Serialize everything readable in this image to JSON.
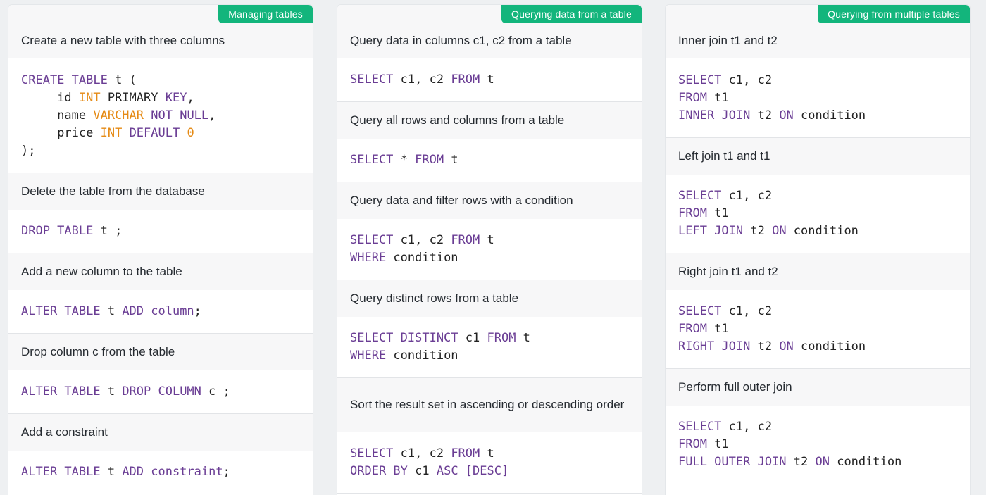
{
  "columns": [
    {
      "badge": "Managing tables",
      "sections": [
        {
          "title": "Create a new table with three columns",
          "title_h": 76,
          "code_h": 163,
          "lines": [
            [
              {
                "t": "CREATE TABLE",
                "c": "k"
              },
              {
                "t": " t (",
                "c": "p"
              }
            ],
            [
              {
                "t": "     id ",
                "c": "p"
              },
              {
                "t": "INT",
                "c": "t"
              },
              {
                "t": " PRIMARY ",
                "c": "p"
              },
              {
                "t": "KEY",
                "c": "k"
              },
              {
                "t": ",",
                "c": "p"
              }
            ],
            [
              {
                "t": "     name ",
                "c": "p"
              },
              {
                "t": "VARCHAR",
                "c": "t"
              },
              {
                "t": " ",
                "c": "p"
              },
              {
                "t": "NOT NULL",
                "c": "k"
              },
              {
                "t": ",",
                "c": "p"
              }
            ],
            [
              {
                "t": "     price ",
                "c": "p"
              },
              {
                "t": "INT",
                "c": "t"
              },
              {
                "t": " ",
                "c": "p"
              },
              {
                "t": "DEFAULT",
                "c": "k"
              },
              {
                "t": " ",
                "c": "p"
              },
              {
                "t": "0",
                "c": "t"
              }
            ],
            [
              {
                "t": ");",
                "c": "p"
              }
            ]
          ]
        },
        {
          "title": "Delete the table from the database",
          "title_h": 52,
          "code_h": 62,
          "lines": [
            [
              {
                "t": "DROP TABLE",
                "c": "k"
              },
              {
                "t": " t ;",
                "c": "p"
              }
            ]
          ]
        },
        {
          "title": "Add a new column to the table",
          "title_h": 52,
          "code_h": 62,
          "lines": [
            [
              {
                "t": "ALTER TABLE",
                "c": "k"
              },
              {
                "t": " t ",
                "c": "p"
              },
              {
                "t": "ADD column",
                "c": "k"
              },
              {
                "t": ";",
                "c": "p"
              }
            ]
          ]
        },
        {
          "title": "Drop column c from the table",
          "title_h": 52,
          "code_h": 62,
          "lines": [
            [
              {
                "t": "ALTER TABLE",
                "c": "k"
              },
              {
                "t": " t ",
                "c": "p"
              },
              {
                "t": "DROP COLUMN",
                "c": "k"
              },
              {
                "t": " c ;",
                "c": "p"
              }
            ]
          ]
        },
        {
          "title": "Add a constraint",
          "title_h": 52,
          "code_h": 62,
          "lines": [
            [
              {
                "t": "ALTER TABLE",
                "c": "k"
              },
              {
                "t": " t ",
                "c": "p"
              },
              {
                "t": "ADD constraint",
                "c": "k"
              },
              {
                "t": ";",
                "c": "p"
              }
            ]
          ]
        }
      ]
    },
    {
      "badge": "Querying data from a table",
      "sections": [
        {
          "title": "Query data in columns c1, c2 from a table",
          "title_h": 76,
          "code_h": 62,
          "lines": [
            [
              {
                "t": "SELECT",
                "c": "k"
              },
              {
                "t": " c1, c2 ",
                "c": "p"
              },
              {
                "t": "FROM",
                "c": "k"
              },
              {
                "t": " t",
                "c": "p"
              }
            ]
          ]
        },
        {
          "title": "Query all rows and columns from a table",
          "title_h": 52,
          "code_h": 62,
          "lines": [
            [
              {
                "t": "SELECT",
                "c": "k"
              },
              {
                "t": " * ",
                "c": "p"
              },
              {
                "t": "FROM",
                "c": "k"
              },
              {
                "t": " t",
                "c": "p"
              }
            ]
          ]
        },
        {
          "title": "Query data and filter rows with a condition",
          "title_h": 52,
          "code_h": 87,
          "lines": [
            [
              {
                "t": "SELECT",
                "c": "k"
              },
              {
                "t": " c1, c2 ",
                "c": "p"
              },
              {
                "t": "FROM",
                "c": "k"
              },
              {
                "t": " t",
                "c": "p"
              }
            ],
            [
              {
                "t": "WHERE",
                "c": "k"
              },
              {
                "t": " condition",
                "c": "p"
              }
            ]
          ]
        },
        {
          "title": "Query distinct rows from a table",
          "title_h": 52,
          "code_h": 87,
          "lines": [
            [
              {
                "t": "SELECT DISTINCT",
                "c": "k"
              },
              {
                "t": " c1 ",
                "c": "p"
              },
              {
                "t": "FROM",
                "c": "k"
              },
              {
                "t": " t",
                "c": "p"
              }
            ],
            [
              {
                "t": "WHERE",
                "c": "k"
              },
              {
                "t": " condition",
                "c": "p"
              }
            ]
          ]
        },
        {
          "title": "Sort the result set in ascending or descending order",
          "title_h": 76,
          "code_h": 88,
          "lines": [
            [
              {
                "t": "SELECT",
                "c": "k"
              },
              {
                "t": " c1, c2 ",
                "c": "p"
              },
              {
                "t": "FROM",
                "c": "k"
              },
              {
                "t": " t",
                "c": "p"
              }
            ],
            [
              {
                "t": "ORDER BY",
                "c": "k"
              },
              {
                "t": " c1 ",
                "c": "p"
              },
              {
                "t": "ASC",
                "c": "k"
              },
              {
                "t": " [DESC]",
                "c": "k"
              }
            ]
          ]
        }
      ]
    },
    {
      "badge": "Querying from multiple tables",
      "sections": [
        {
          "title": "Inner join t1 and t2",
          "title_h": 76,
          "code_h": 113,
          "lines": [
            [
              {
                "t": "SELECT",
                "c": "k"
              },
              {
                "t": " c1, c2",
                "c": "p"
              }
            ],
            [
              {
                "t": "FROM",
                "c": "k"
              },
              {
                "t": " t1",
                "c": "p"
              }
            ],
            [
              {
                "t": "INNER JOIN",
                "c": "k"
              },
              {
                "t": " t2 ",
                "c": "p"
              },
              {
                "t": "ON",
                "c": "k"
              },
              {
                "t": " condition",
                "c": "p"
              }
            ]
          ]
        },
        {
          "title": "Left join t1 and t1",
          "title_h": 52,
          "code_h": 112,
          "lines": [
            [
              {
                "t": "SELECT",
                "c": "k"
              },
              {
                "t": " c1, c2",
                "c": "p"
              }
            ],
            [
              {
                "t": "FROM",
                "c": "k"
              },
              {
                "t": " t1",
                "c": "p"
              }
            ],
            [
              {
                "t": "LEFT JOIN",
                "c": "k"
              },
              {
                "t": " t2 ",
                "c": "p"
              },
              {
                "t": "ON",
                "c": "k"
              },
              {
                "t": " condition",
                "c": "p"
              }
            ]
          ]
        },
        {
          "title": "Right join t1 and t2",
          "title_h": 52,
          "code_h": 112,
          "lines": [
            [
              {
                "t": "SELECT",
                "c": "k"
              },
              {
                "t": " c1, c2",
                "c": "p"
              }
            ],
            [
              {
                "t": "FROM",
                "c": "k"
              },
              {
                "t": " t1",
                "c": "p"
              }
            ],
            [
              {
                "t": "RIGHT JOIN",
                "c": "k"
              },
              {
                "t": " t2 ",
                "c": "p"
              },
              {
                "t": "ON",
                "c": "k"
              },
              {
                "t": " condition",
                "c": "p"
              }
            ]
          ]
        },
        {
          "title": "Perform full outer join",
          "title_h": 52,
          "code_h": 112,
          "lines": [
            [
              {
                "t": "SELECT",
                "c": "k"
              },
              {
                "t": " c1, c2",
                "c": "p"
              }
            ],
            [
              {
                "t": "FROM",
                "c": "k"
              },
              {
                "t": " t1",
                "c": "p"
              }
            ],
            [
              {
                "t": "FULL OUTER JOIN",
                "c": "k"
              },
              {
                "t": " t2 ",
                "c": "p"
              },
              {
                "t": "ON",
                "c": "k"
              },
              {
                "t": " condition",
                "c": "p"
              }
            ]
          ]
        }
      ]
    }
  ],
  "colors": {
    "keyword": "#6a3d94",
    "type": "#e58a14",
    "plain": "#222222",
    "badge": "#13b57c"
  }
}
